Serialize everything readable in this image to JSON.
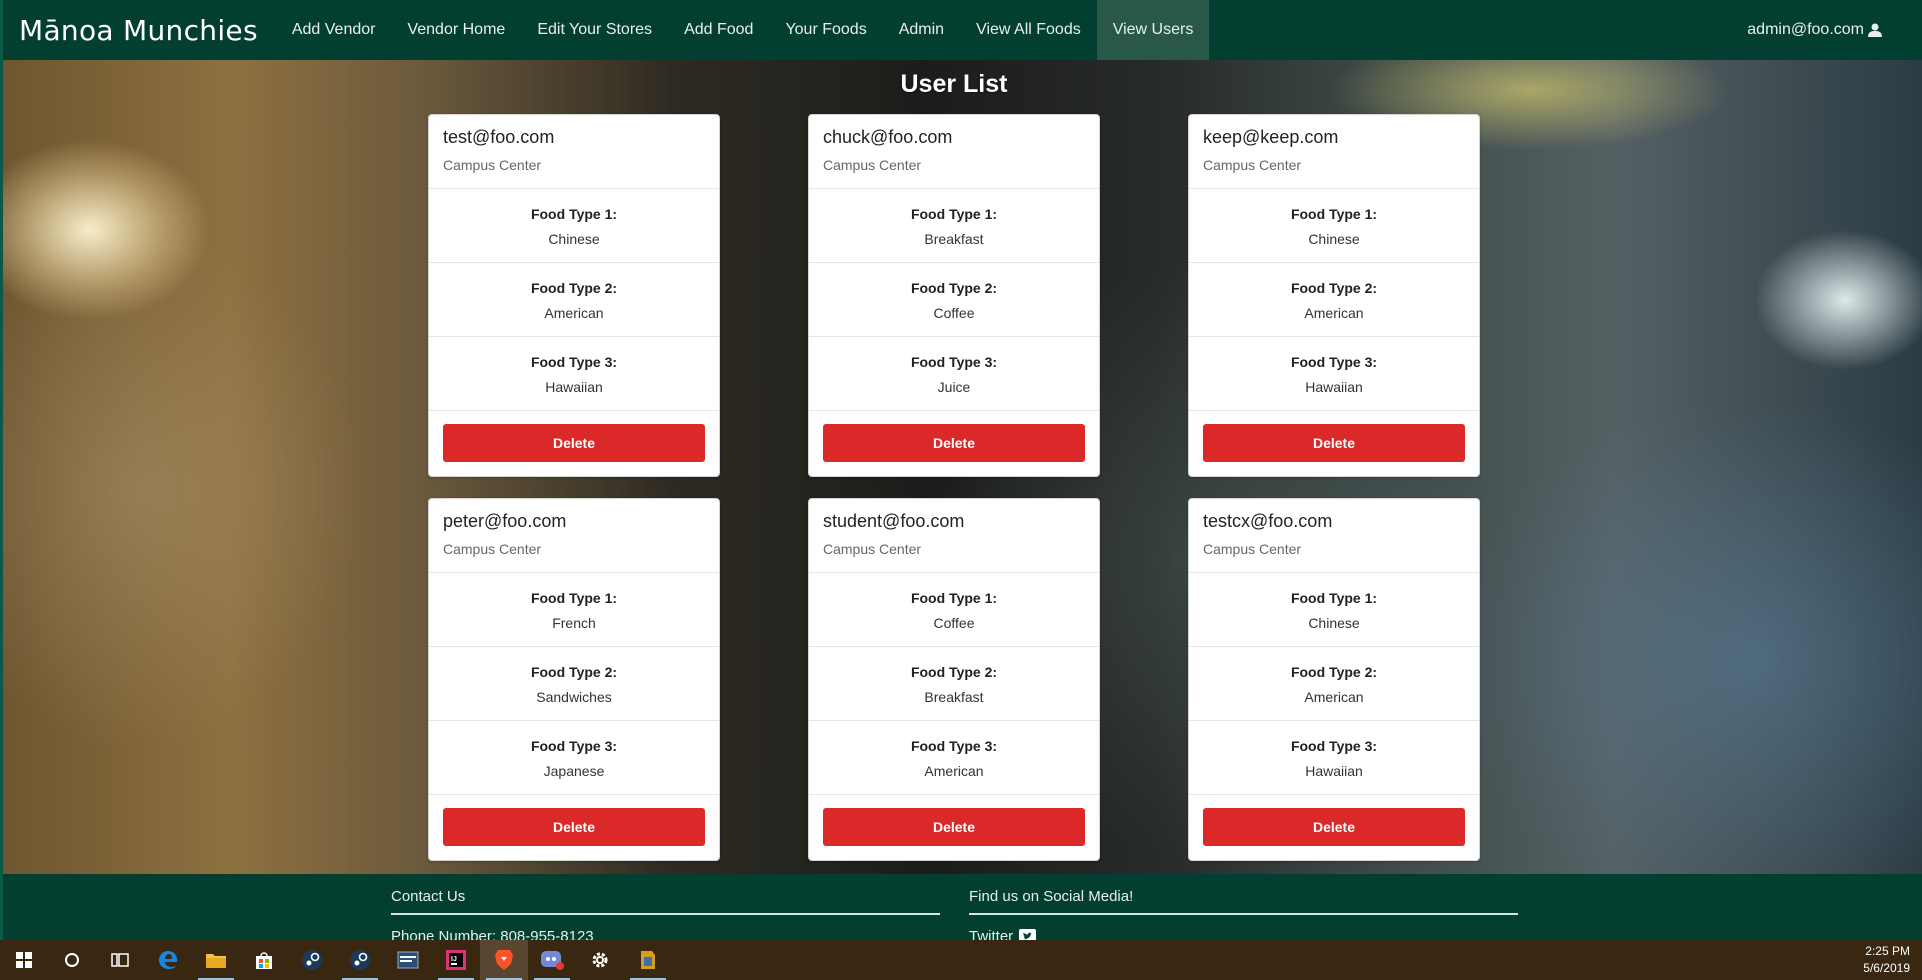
{
  "navbar": {
    "brand": "Mānoa Munchies",
    "items": [
      "Add Vendor",
      "Vendor Home",
      "Edit Your Stores",
      "Add Food",
      "Your Foods",
      "Admin",
      "View All Foods",
      "View Users"
    ],
    "active": "View Users",
    "user": "admin@foo.com",
    "user_icon": "user-icon"
  },
  "page": {
    "title": "User List"
  },
  "food_labels": [
    "Food Type 1:",
    "Food Type 2:",
    "Food Type 3:"
  ],
  "delete_label": "Delete",
  "users": [
    {
      "email": "test@foo.com",
      "location": "Campus Center",
      "foods": [
        "Chinese",
        "American",
        "Hawaiian"
      ]
    },
    {
      "email": "chuck@foo.com",
      "location": "Campus Center",
      "foods": [
        "Breakfast",
        "Coffee",
        "Juice"
      ]
    },
    {
      "email": "keep@keep.com",
      "location": "Campus Center",
      "foods": [
        "Chinese",
        "American",
        "Hawaiian"
      ]
    },
    {
      "email": "peter@foo.com",
      "location": "Campus Center",
      "foods": [
        "French",
        "Sandwiches",
        "Japanese"
      ]
    },
    {
      "email": "student@foo.com",
      "location": "Campus Center",
      "foods": [
        "Coffee",
        "Breakfast",
        "American"
      ]
    },
    {
      "email": "testcx@foo.com",
      "location": "Campus Center",
      "foods": [
        "Chinese",
        "American",
        "Hawaiian"
      ]
    }
  ],
  "footer": {
    "contact_heading": "Contact Us",
    "phone": "Phone Number: 808-955-8123",
    "social_heading": "Find us on Social Media!",
    "twitter": "Twitter",
    "twitter_icon": "twitter-icon"
  },
  "taskbar": {
    "icons": [
      "windows-start-icon",
      "cortana-search-icon",
      "task-view-icon",
      "edge-browser-icon",
      "file-explorer-icon",
      "store-icon",
      "steam-icon",
      "steam-icon",
      "app-window-icon",
      "intellij-icon",
      "brave-browser-icon",
      "discord-icon",
      "settings-gear-icon",
      "app-icon"
    ],
    "time": "2:25 PM",
    "date": "5/6/2019"
  },
  "colors": {
    "navbar": "#023f31",
    "active_nav": "#295848",
    "delete": "#db2828",
    "taskbar": "#3a2712"
  }
}
